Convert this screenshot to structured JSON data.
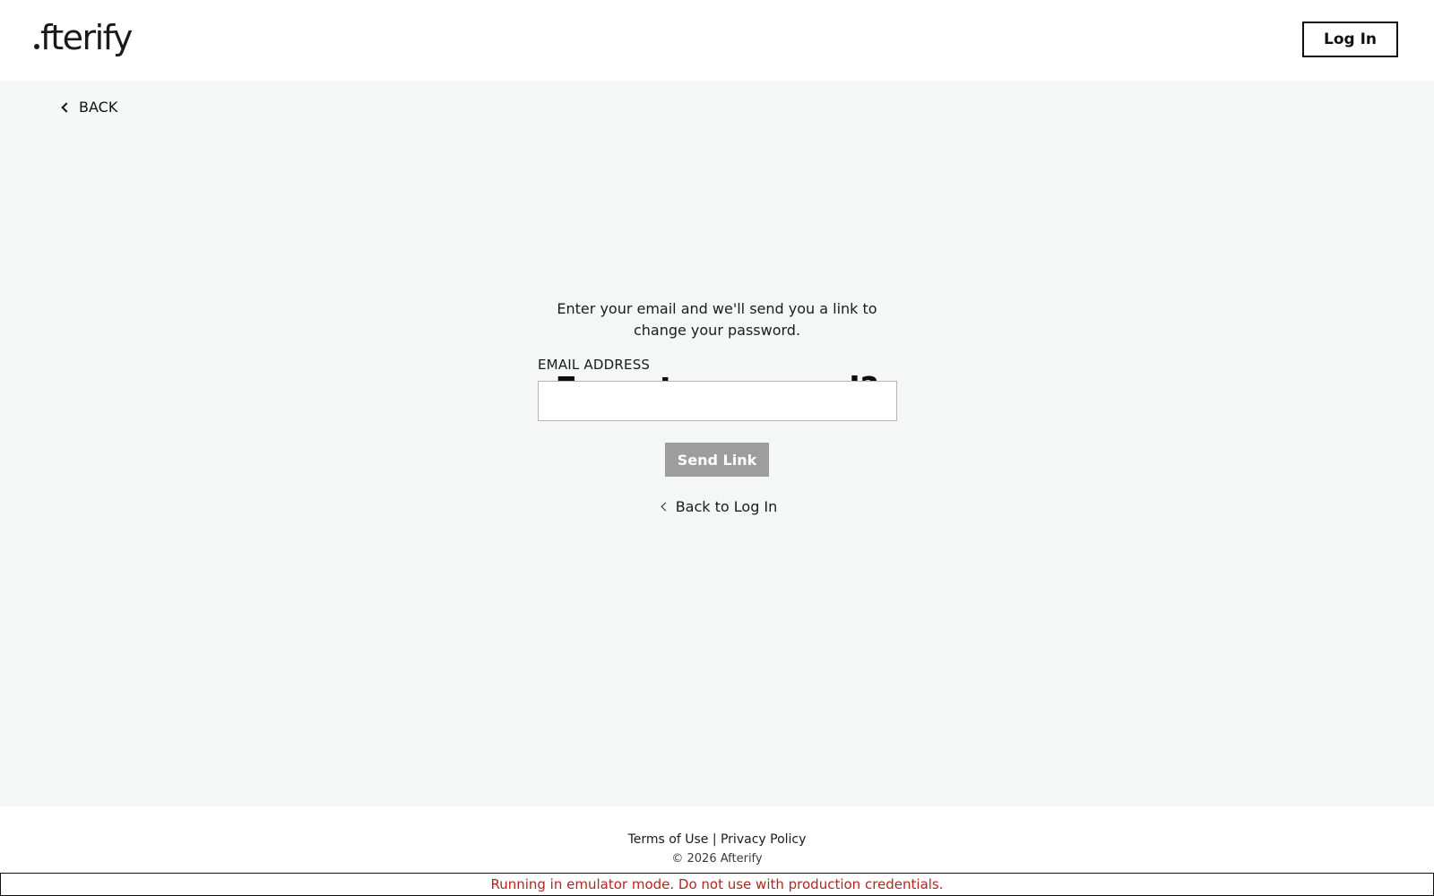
{
  "header": {
    "logo_text": "fterify",
    "login_label": "Log In"
  },
  "nav": {
    "back_label": "BACK"
  },
  "form": {
    "title": "Forgot password?",
    "subtitle_line1": "Enter your email and we'll send you a link to",
    "subtitle_line2": "change your password.",
    "email_label": "EMAIL ADDRESS",
    "email_value": "",
    "send_label": "Send Link",
    "back_to_login": "Back to Log In"
  },
  "footer": {
    "terms": "Terms of Use",
    "separator": "|",
    "privacy": "Privacy Policy",
    "copyright": "© 2026 Afterify"
  },
  "banner": {
    "text": "Running in emulator mode. Do not use with production credentials."
  },
  "icons": {
    "back": "chevron-left-icon",
    "back_to_login": "chevron-left-icon"
  },
  "colors": {
    "page_bg": "#f6f7f7",
    "send_button_disabled": "#9d9d9d",
    "banner_text": "#b3261e"
  }
}
